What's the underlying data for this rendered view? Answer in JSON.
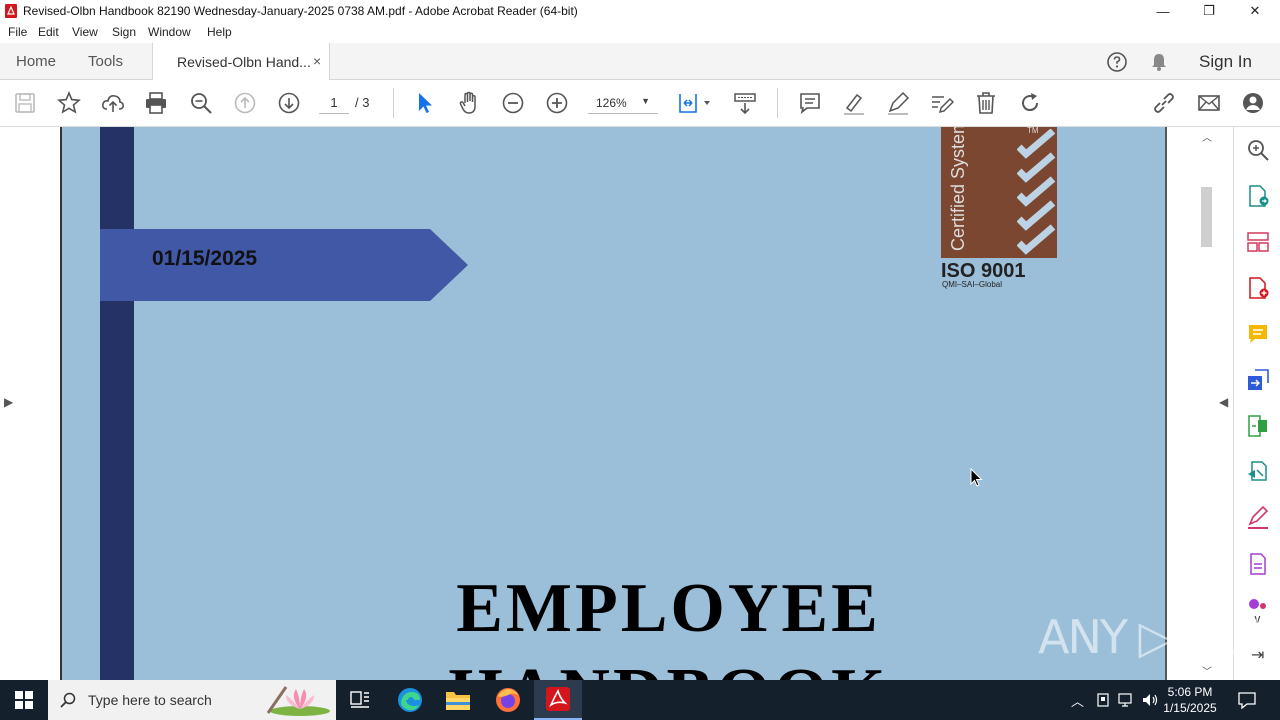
{
  "window": {
    "title": "Revised-Olbn Handbook 82190 Wednesday-January-2025 0738 AM.pdf - Adobe Acrobat Reader (64-bit)",
    "minimize": "—",
    "maximize": "❐",
    "close": "✕"
  },
  "menu": [
    "File",
    "Edit",
    "View",
    "Sign",
    "Window",
    "Help"
  ],
  "tabs": {
    "home": "Home",
    "tools": "Tools",
    "document": "Revised-Olbn Hand...",
    "document_close": "×",
    "sign_in": "Sign In"
  },
  "toolbar": {
    "page_current": "1",
    "page_total": "/ 3",
    "zoom": "126%"
  },
  "document": {
    "date": "01/15/2025",
    "cert_label": "Certified System",
    "cert_tm": "TM",
    "iso": "ISO 9001",
    "iso_sub": "QMI–SAI–Global",
    "headline_line1": "EMPLOYEE",
    "headline_line2": "HANDBOOK"
  },
  "watermark": "ANY ▷ RUN",
  "taskbar": {
    "search_placeholder": "Type here to search",
    "time": "5:06 PM",
    "date": "1/15/2025"
  },
  "colors": {
    "page_bg": "#9bbfd9",
    "stripe": "#253266",
    "banner": "#4158a6",
    "cert": "#7c4731",
    "acrobat_red": "#d4151c",
    "accent_blue": "#1473e6"
  }
}
